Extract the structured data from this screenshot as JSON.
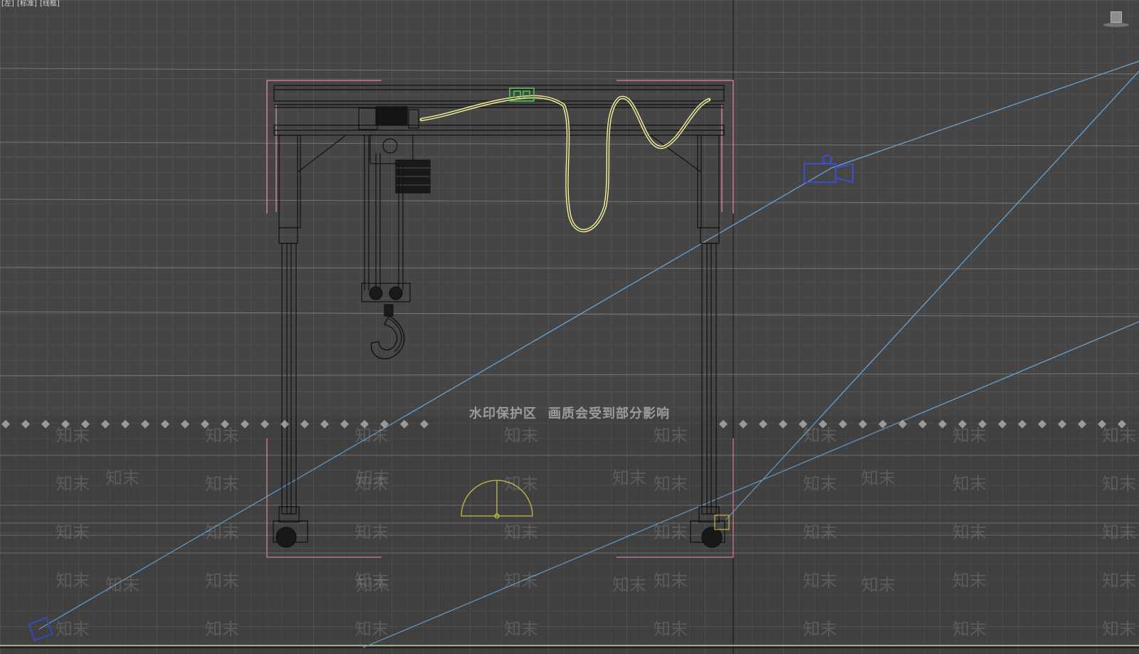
{
  "viewport": {
    "label_parts": [
      "[左]",
      "[标准]",
      "[线框]"
    ],
    "active_view": "左",
    "shading_mode": "线框"
  },
  "watermark": {
    "banner_left": "水印保护区",
    "banner_right": "画质会受到部分影响",
    "tile_text": "知末"
  },
  "scene": {
    "grid_color": "#585858",
    "grid_major_color": "#6a6a6a",
    "background": "#454545",
    "crane_wire_color": "#111111",
    "cable_selected_color": "#f2ef9a",
    "bounding_box_color": "#e08aa0",
    "camera_line_color": "#6aa8d8",
    "camera_icon_color": "#3a4fd0",
    "light_gizmo_color": "#d8c84a",
    "tag_color": "#50c850"
  },
  "icons": {
    "viewcube": "viewcube-icon",
    "camera": "camera-icon",
    "light": "light-icon"
  }
}
